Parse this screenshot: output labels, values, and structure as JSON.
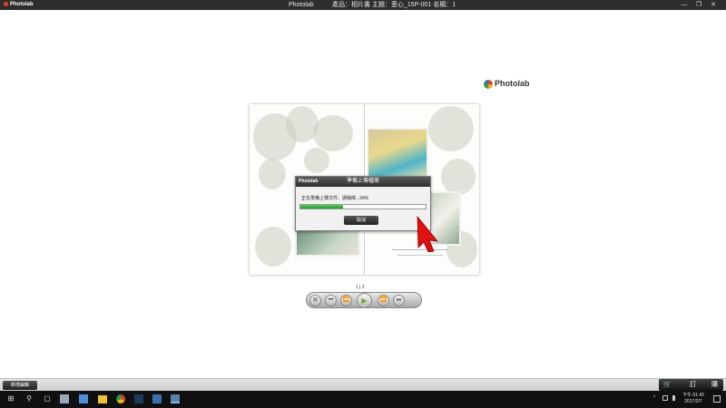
{
  "titlebar": {
    "logo": "Photolab",
    "app_name": "Photolab",
    "info": "產品：相片書  主題：愛心_15P-001  名稱：1",
    "minimize": "—",
    "restore": "❐",
    "close": "✕"
  },
  "brand": {
    "text": "Photolab"
  },
  "dialog": {
    "title": "準備上傳檔案",
    "logo": "Photolab",
    "message": "正在準備上傳文件，請稍候...34%",
    "progress": 0.34,
    "cancel_label": "取消"
  },
  "pager": {
    "text": "1 | 2"
  },
  "controls": {
    "grid": "⊞",
    "first": "⏮",
    "prev": "⏪",
    "play": "▶",
    "next": "⏩",
    "last": "⏭"
  },
  "statusbar": {
    "new_label": "新增編輯",
    "order_cart": "🛒",
    "order_t1": "訂",
    "order_t2": "購"
  },
  "taskbar": {
    "start": "⊞",
    "search": "⚲",
    "taskview": "▢",
    "tray_caret": "^",
    "clock_time": "下午 01:42",
    "clock_date": "2017/2/7"
  },
  "colors": {
    "titlebar": "#2d2d2d",
    "progress_fill": "#1c9b2a",
    "cursor_red": "#e01010",
    "taskbar": "#101010"
  }
}
